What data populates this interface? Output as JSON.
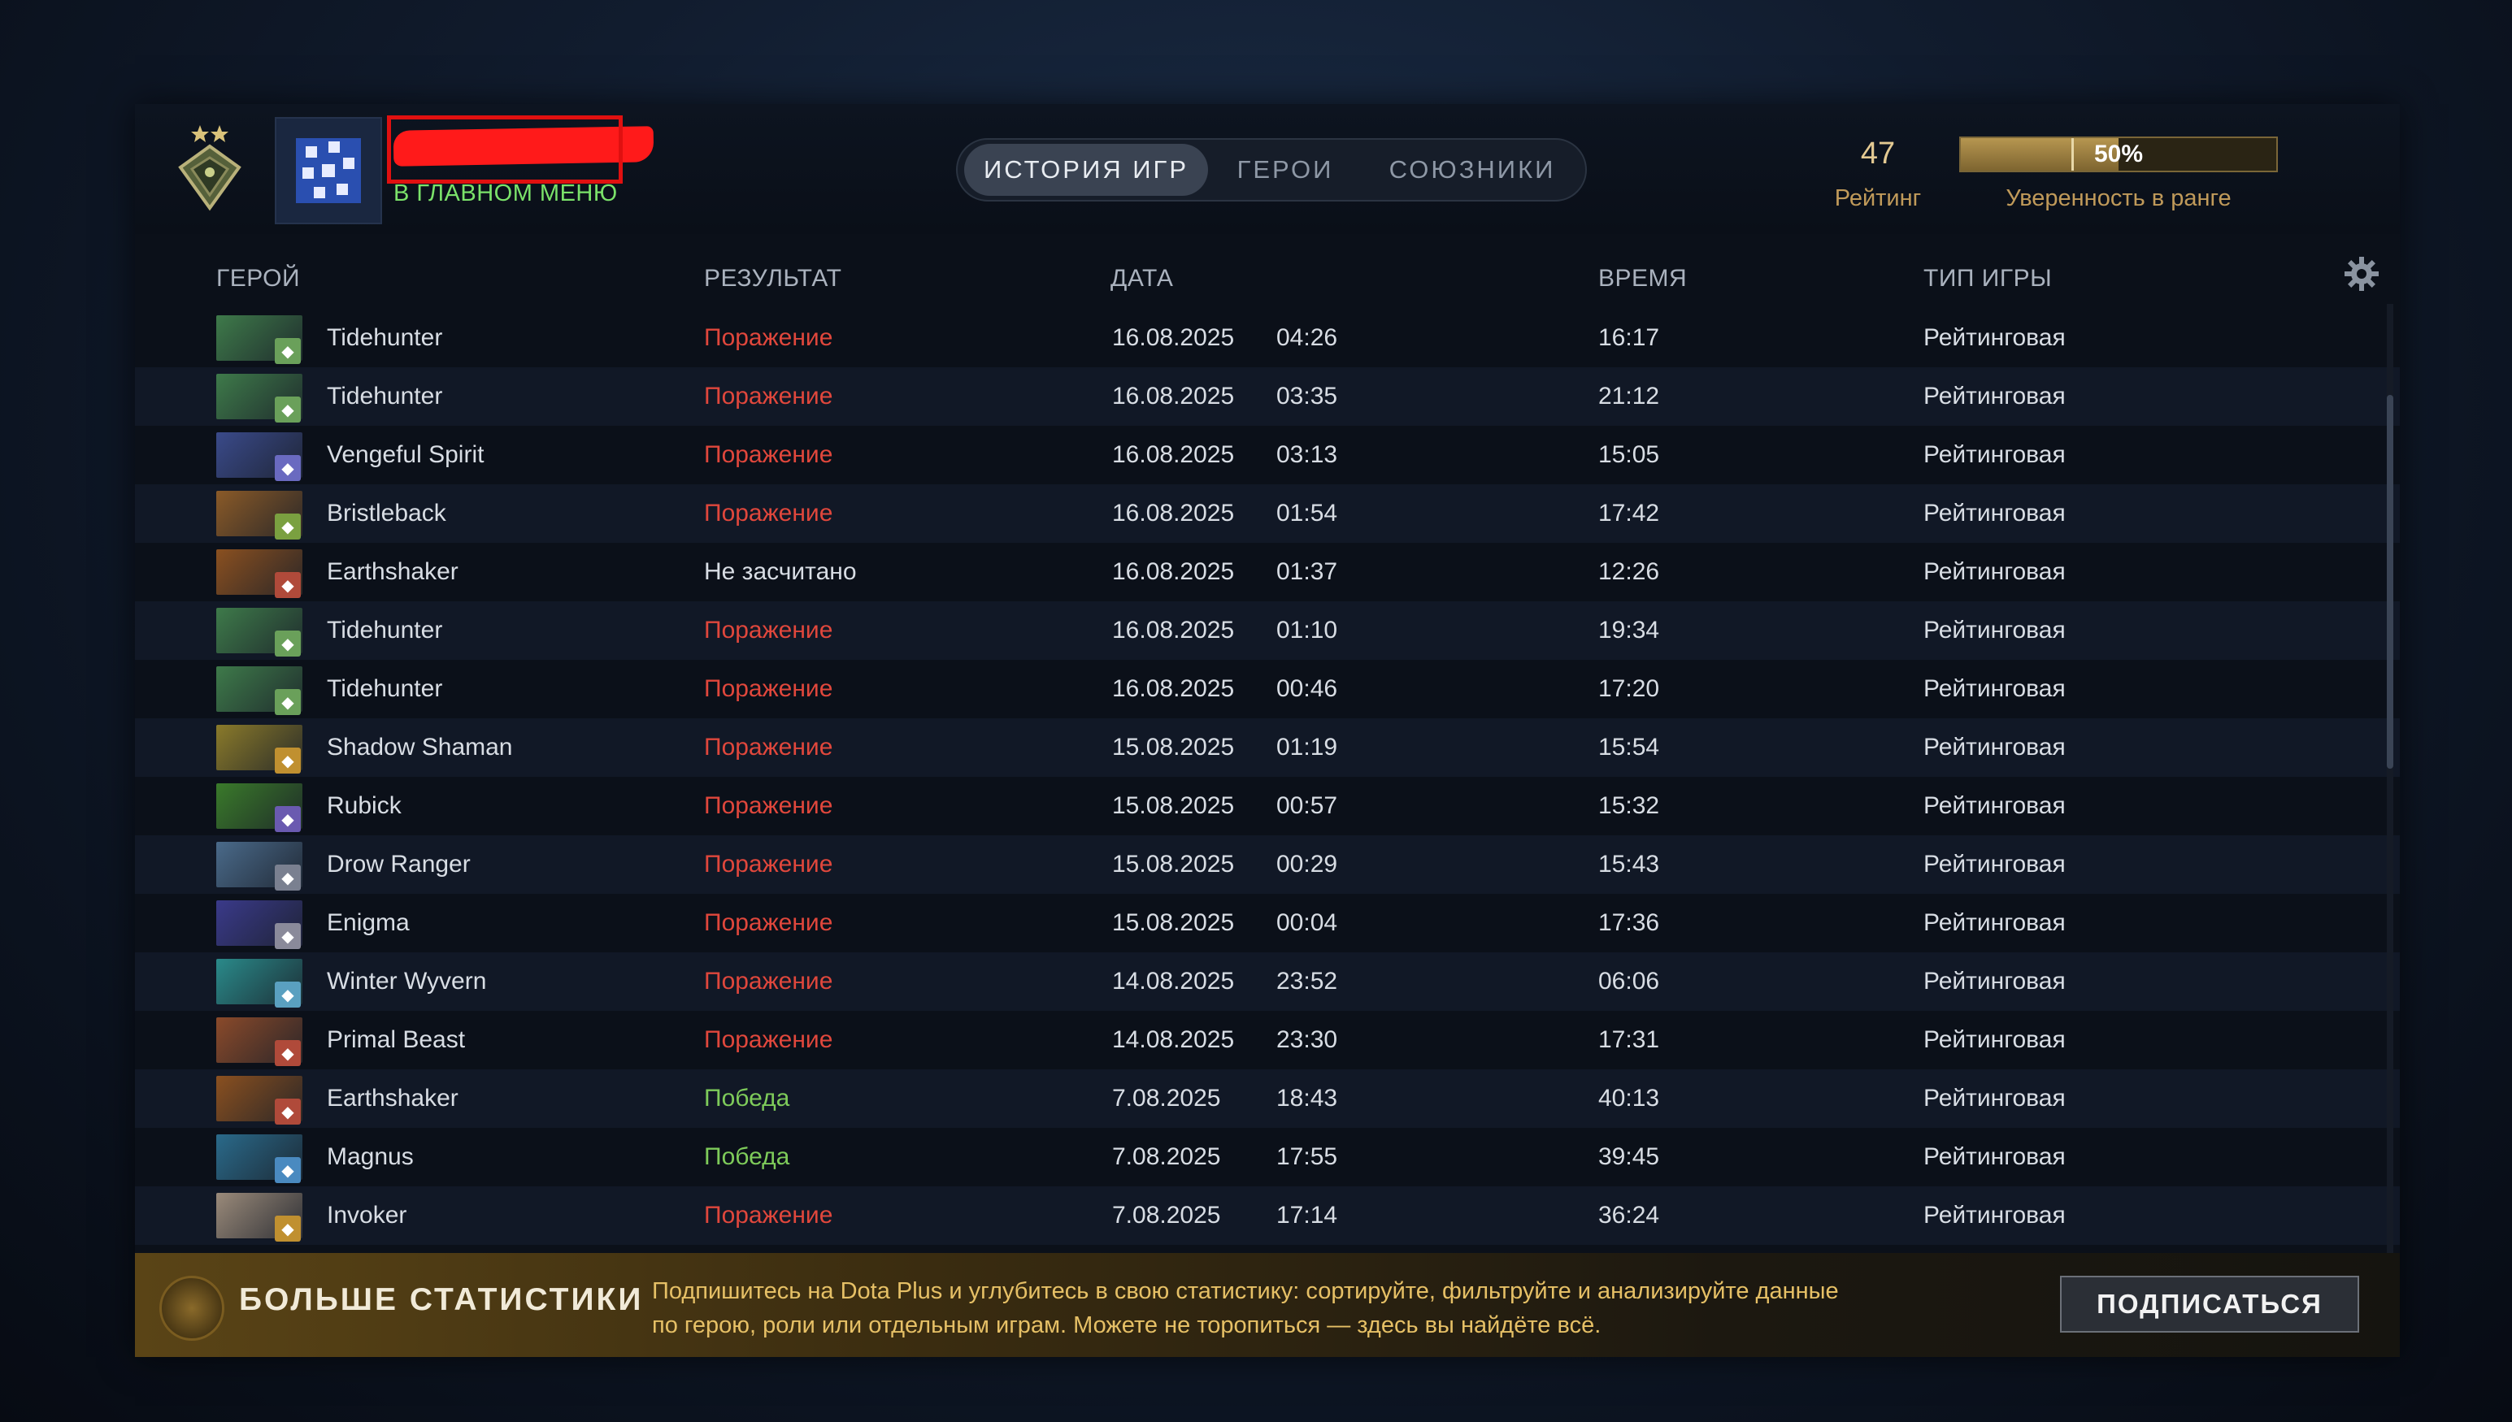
{
  "header": {
    "status_text": "В ГЛАВНОМ МЕНЮ",
    "tabs": [
      {
        "label": "ИСТОРИЯ ИГР",
        "active": true
      },
      {
        "label": "ГЕРОИ",
        "active": false
      },
      {
        "label": "СОЮЗНИКИ",
        "active": false
      }
    ],
    "rating_value": "47",
    "rating_label": "Рейтинг",
    "confidence_value": "50%",
    "confidence_fraction": 0.5,
    "confidence_label": "Уверенность в ранге"
  },
  "columns": {
    "hero": "ГЕРОЙ",
    "result": "РЕЗУЛЬТАТ",
    "date": "ДАТА",
    "duration": "ВРЕМЯ",
    "game_type": "ТИП ИГРЫ"
  },
  "matches": [
    {
      "hero": "Tidehunter",
      "result": "Поражение",
      "outcome": "loss",
      "date": "16.08.2025",
      "time": "04:26",
      "duration": "16:17",
      "type": "Рейтинговая",
      "color": "#3e7a4a",
      "badge_color": "#6aa05a",
      "badge_icon": "shield-icon"
    },
    {
      "hero": "Tidehunter",
      "result": "Поражение",
      "outcome": "loss",
      "date": "16.08.2025",
      "time": "03:35",
      "duration": "21:12",
      "type": "Рейтинговая",
      "color": "#3e7a4a",
      "badge_color": "#6aa05a",
      "badge_icon": "shield-icon"
    },
    {
      "hero": "Vengeful Spirit",
      "result": "Поражение",
      "outcome": "loss",
      "date": "16.08.2025",
      "time": "03:13",
      "duration": "15:05",
      "type": "Рейтинговая",
      "color": "#3a4a8a",
      "badge_color": "#6a6ac0",
      "badge_icon": "hand-icon"
    },
    {
      "hero": "Bristleback",
      "result": "Поражение",
      "outcome": "loss",
      "date": "16.08.2025",
      "time": "01:54",
      "duration": "17:42",
      "type": "Рейтинговая",
      "color": "#8a5a28",
      "badge_color": "#7aa040",
      "badge_icon": "boot-icon"
    },
    {
      "hero": "Earthshaker",
      "result": "Не засчитано",
      "outcome": "none",
      "date": "16.08.2025",
      "time": "01:37",
      "duration": "12:26",
      "type": "Рейтинговая",
      "color": "#8a5020",
      "badge_color": "#b04a3a",
      "badge_icon": "circle-icon"
    },
    {
      "hero": "Tidehunter",
      "result": "Поражение",
      "outcome": "loss",
      "date": "16.08.2025",
      "time": "01:10",
      "duration": "19:34",
      "type": "Рейтинговая",
      "color": "#3e7a4a",
      "badge_color": "#6aa05a",
      "badge_icon": "shield-icon"
    },
    {
      "hero": "Tidehunter",
      "result": "Поражение",
      "outcome": "loss",
      "date": "16.08.2025",
      "time": "00:46",
      "duration": "17:20",
      "type": "Рейтинговая",
      "color": "#3e7a4a",
      "badge_color": "#6aa05a",
      "badge_icon": "shield-icon"
    },
    {
      "hero": "Shadow Shaman",
      "result": "Поражение",
      "outcome": "loss",
      "date": "15.08.2025",
      "time": "01:19",
      "duration": "15:54",
      "type": "Рейтинговая",
      "color": "#8a7a2a",
      "badge_color": "#c09030",
      "badge_icon": "totem-icon"
    },
    {
      "hero": "Rubick",
      "result": "Поражение",
      "outcome": "loss",
      "date": "15.08.2025",
      "time": "00:57",
      "duration": "15:32",
      "type": "Рейтинговая",
      "color": "#3a7a2a",
      "badge_color": "#6a5ab0",
      "badge_icon": "person-icon"
    },
    {
      "hero": "Drow Ranger",
      "result": "Поражение",
      "outcome": "loss",
      "date": "15.08.2025",
      "time": "00:29",
      "duration": "15:43",
      "type": "Рейтинговая",
      "color": "#4a6a8a",
      "badge_color": "#7a8090",
      "badge_icon": "sword-icon"
    },
    {
      "hero": "Enigma",
      "result": "Поражение",
      "outcome": "loss",
      "date": "15.08.2025",
      "time": "00:04",
      "duration": "17:36",
      "type": "Рейтинговая",
      "color": "#3a3a8a",
      "badge_color": "#8a8a9a",
      "badge_icon": "wand-icon"
    },
    {
      "hero": "Winter Wyvern",
      "result": "Поражение",
      "outcome": "loss",
      "date": "14.08.2025",
      "time": "23:52",
      "duration": "06:06",
      "type": "Рейтинговая",
      "color": "#2a8a8a",
      "badge_color": "#5aa0c0",
      "badge_icon": "tower-icon"
    },
    {
      "hero": "Primal Beast",
      "result": "Поражение",
      "outcome": "loss",
      "date": "14.08.2025",
      "time": "23:30",
      "duration": "17:31",
      "type": "Рейтинговая",
      "color": "#8a4a2a",
      "badge_color": "#b04a3a",
      "badge_icon": "arrows-icon"
    },
    {
      "hero": "Earthshaker",
      "result": "Победа",
      "outcome": "win",
      "date": "7.08.2025",
      "time": "18:43",
      "duration": "40:13",
      "type": "Рейтинговая",
      "color": "#8a5020",
      "badge_color": "#b04a3a",
      "badge_icon": "circle-icon"
    },
    {
      "hero": "Magnus",
      "result": "Победа",
      "outcome": "win",
      "date": "7.08.2025",
      "time": "17:55",
      "duration": "39:45",
      "type": "Рейтинговая",
      "color": "#2a6a8a",
      "badge_color": "#4a8ac0",
      "badge_icon": "wand-icon"
    },
    {
      "hero": "Invoker",
      "result": "Поражение",
      "outcome": "loss",
      "date": "7.08.2025",
      "time": "17:14",
      "duration": "36:24",
      "type": "Рейтинговая",
      "color": "#9a8a7a",
      "badge_color": "#c09030",
      "badge_icon": "orbs-icon"
    }
  ],
  "banner": {
    "title": "БОЛЬШЕ СТАТИСТИКИ",
    "text_line1": "Подпишитесь на Dota Plus и углубитесь в свою статистику: сортируйте, фильтруйте и анализируйте данные",
    "text_line2": "по герою, роли или отдельным играм. Можете не торопиться — здесь вы найдёте всё.",
    "button": "ПОДПИСАТЬСЯ"
  },
  "colors": {
    "loss": "#e0473c",
    "win": "#7ecb5a",
    "accent_gold": "#c09a5a"
  }
}
